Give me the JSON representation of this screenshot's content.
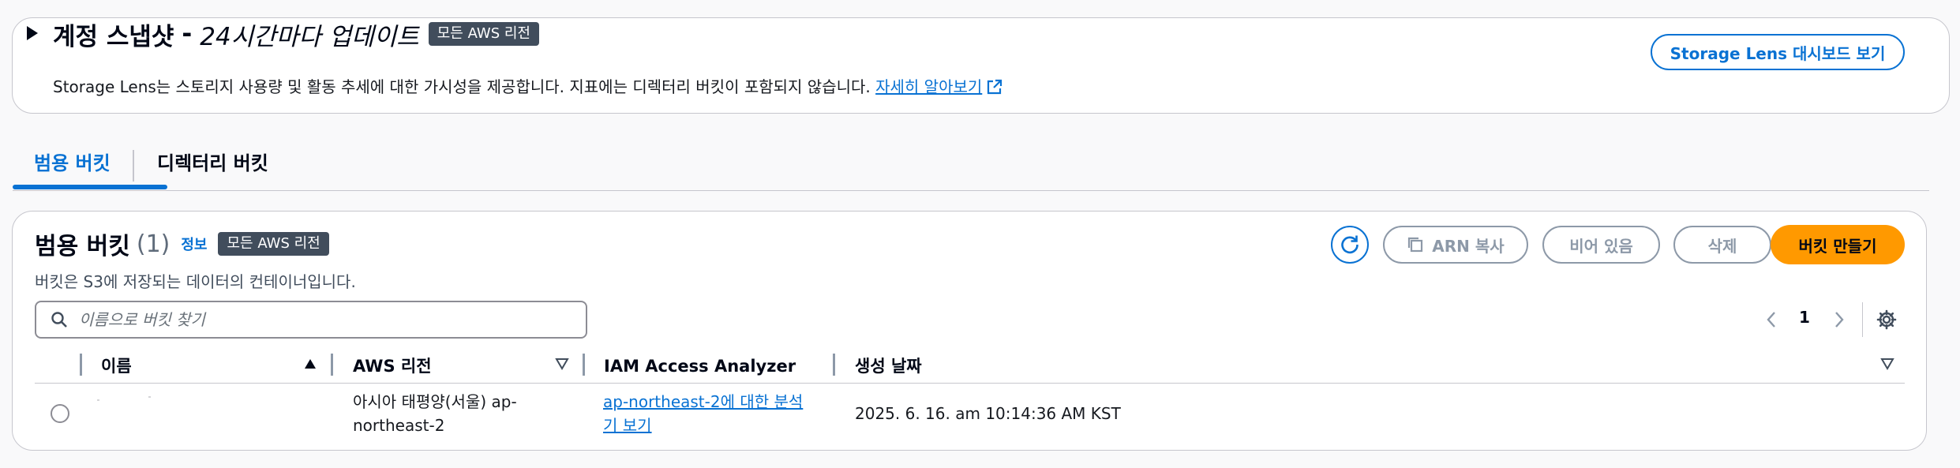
{
  "snapshot": {
    "title_bold": "계정 스냅샷",
    "title_sep": "-",
    "title_italic": "24시간마다 업데이트",
    "region_badge": "모든 AWS 리전",
    "description": "Storage Lens는 스토리지 사용량 및 활동 추세에 대한 가시성을 제공합니다. 지표에는 디렉터리 버킷이 포함되지 않습니다.",
    "learn_more": "자세히 알아보기",
    "lens_button": "Storage Lens 대시보드 보기"
  },
  "tabs": [
    {
      "label": "범용 버킷",
      "active": true
    },
    {
      "label": "디렉터리 버킷",
      "active": false
    }
  ],
  "buckets": {
    "title": "범용 버킷",
    "count": "(1)",
    "info": "정보",
    "region_badge": "모든 AWS 리전",
    "description": "버킷은 S3에 저장되는 데이터의 컨테이너입니다.",
    "actions": {
      "copy_arn": "ARN 복사",
      "empty": "비어 있음",
      "delete": "삭제",
      "create": "버킷 만들기"
    },
    "search_placeholder": "이름으로 버킷 찾기",
    "page": "1",
    "columns": {
      "name": "이름",
      "region": "AWS 리전",
      "iam": "IAM Access Analyzer",
      "created": "생성 날짜"
    },
    "rows": [
      {
        "name": "",
        "region": "아시아 태평양(서울) ap-northeast-2",
        "iam_link": "ap-northeast-2에 대한 분석기 보기",
        "created": "2025. 6. 16. am 10:14:36 AM KST"
      }
    ]
  },
  "colors": {
    "link": "#0972d3",
    "primary_button": "#ff9900",
    "badge": "#414d5c",
    "disabled": "#8d99a8"
  }
}
